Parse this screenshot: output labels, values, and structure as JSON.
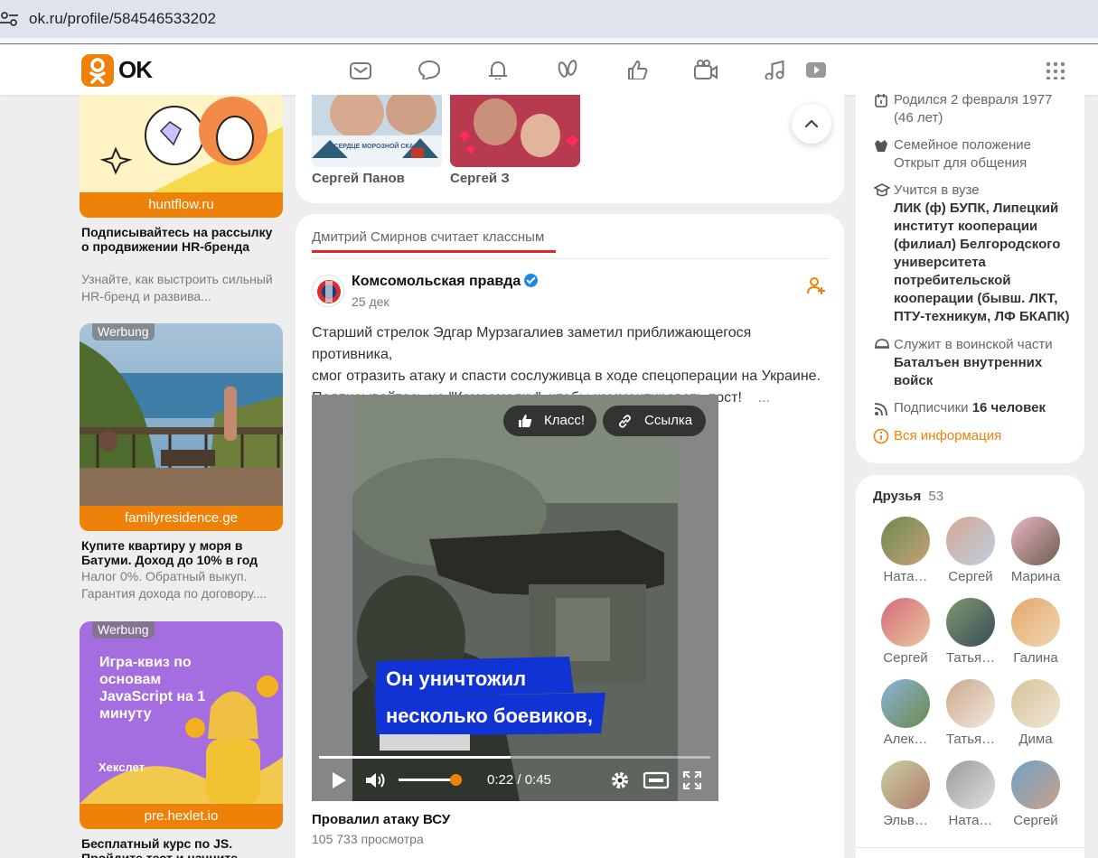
{
  "browser": {
    "url": "ok.ru/profile/584546533202"
  },
  "header": {
    "logo_text": "OK",
    "nav_icons": [
      "mail-icon",
      "chat-icon",
      "bell-icon",
      "guests-icon",
      "like-icon",
      "camera-icon",
      "music-icon",
      "video-icon"
    ]
  },
  "ads": [
    {
      "domain": "huntflow.ru",
      "title": "Подписывайтесь на рассылку о продвижении HR-бренда",
      "desc": "Узнайте, как выстроить сильный HR-бренд и развива..."
    },
    {
      "label": "Werbung",
      "domain": "familyresidence.ge",
      "title": "Купите квартиру у моря в Батуми. Доход до 10% в год",
      "desc": "Налог 0%. Обратный выкуп. Гарантия дохода по договору...."
    },
    {
      "label": "Werbung",
      "domain": "pre.hexlet.io",
      "title": "Бесплатный курс по JS. Пройдите тест и начните",
      "image_text": "Игра-квиз по основам JavaScript на 1 минуту",
      "image_brand": "Хекслет"
    }
  ],
  "top_card": {
    "people": [
      {
        "name": "Сергей Панов",
        "photo_caption": "В СЕРДЦЕ МОРОЗНОЙ СКАЗКИ"
      },
      {
        "name": "Сергей З"
      }
    ]
  },
  "post": {
    "activity": "Дмитрий Смирнов считает классным",
    "author": "Комсомольская правда",
    "date": "25 дек",
    "text_lines": [
      "Старший стрелок Эдгар Мурзагалиев заметил приближающегося противника,",
      "смог отразить атаку и спасти сослуживца в ходе спецоперации на Украине.",
      "Подписывайтесь на \"Комсомолку\", чтобы комментировать пост!"
    ],
    "text_more": "...",
    "video": {
      "like_btn": "Класс!",
      "link_btn": "Ссылка",
      "subtitle_1": "Он уничтожил",
      "subtitle_2": "несколько боевиков,",
      "time": "0:22 / 0:45",
      "progress": 0.49,
      "volume": 0.9
    },
    "video_title": "Провалил атаку ВСУ",
    "views": "105 733 просмотра"
  },
  "profile_info": {
    "birth_line1": "Родился 2 февраля 1977",
    "birth_line2": "(46 лет)",
    "family_label": "Семейное положение",
    "family_value": "Открыт для общения",
    "study_label": "Учится в вузе",
    "study_value": [
      "ЛИК (ф) БУПК, Липецкий",
      "институт кооперации",
      "(филиал) Белгородского",
      "университета",
      "потребительской",
      "кооперации (бывш. ЛКТ,",
      "ПТУ-техникум, ЛФ БКАПК)"
    ],
    "army_label": "Служит в воинской части",
    "army_value": [
      "Баталъен внутренних",
      "войск"
    ],
    "subs_label": "Подписчики",
    "subs_value": "16 человек",
    "all_info": "Вся информация"
  },
  "friends": {
    "title": "Друзья",
    "count": "53",
    "items": [
      {
        "name": "Ната…"
      },
      {
        "name": "Сергей"
      },
      {
        "name": "Марина"
      },
      {
        "name": "Сергей"
      },
      {
        "name": "Татья…"
      },
      {
        "name": "Галина"
      },
      {
        "name": "Алек…"
      },
      {
        "name": "Татья…"
      },
      {
        "name": "Дима"
      },
      {
        "name": "Эльв…"
      },
      {
        "name": "Ната…"
      },
      {
        "name": "Сергей"
      }
    ]
  },
  "colors": {
    "accent": "#ee8208",
    "underline": "#e0262a",
    "verified": "#1e88e5"
  }
}
